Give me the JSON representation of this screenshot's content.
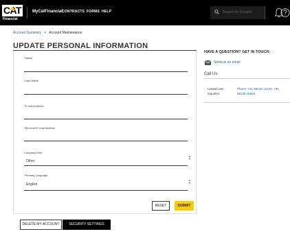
{
  "nav": {
    "logo_text": "CAT",
    "logo_sub": "Financial",
    "brand": "MyCatFinancial",
    "links": [
      "CONTRACTS",
      "FORMS",
      "HELP"
    ],
    "search_placeholder": "Search for Content"
  },
  "breadcrumb": {
    "parent": "Account Summary",
    "separator": ">",
    "current": "Account Maintenance"
  },
  "page_title": "UPDATE PERSONAL INFORMATION",
  "form": {
    "name_label": "Name",
    "last_name_label": "Last Name",
    "email_label": "E-mail Address",
    "reemail_label": "Re-enter E-mail Address",
    "company_role_label": "Company Role",
    "company_role_value": "Other",
    "language_label": "Primary Language",
    "language_value": "English",
    "required_mark": "*",
    "reset_label": "RESET",
    "submit_label": "SUBMIT"
  },
  "bottom_tabs": {
    "delete_label": "DELETE MY ACCOUNT",
    "security_label": "SECURITY SETTINGS"
  },
  "help": {
    "title": "HAVE A QUESTION? GET IN TOUCH:",
    "email_link": "Send us an email",
    "call_title": "Call Us",
    "call_label_1": "Lease/Loan",
    "call_label_2": "Inquiries:",
    "phone_1": "Phone: +91 95135 12120, +91",
    "phone_2": "95135 16916"
  },
  "colors": {
    "accent": "#ffcc00",
    "nav_bg": "#000000",
    "link": "#1a5eb8"
  }
}
